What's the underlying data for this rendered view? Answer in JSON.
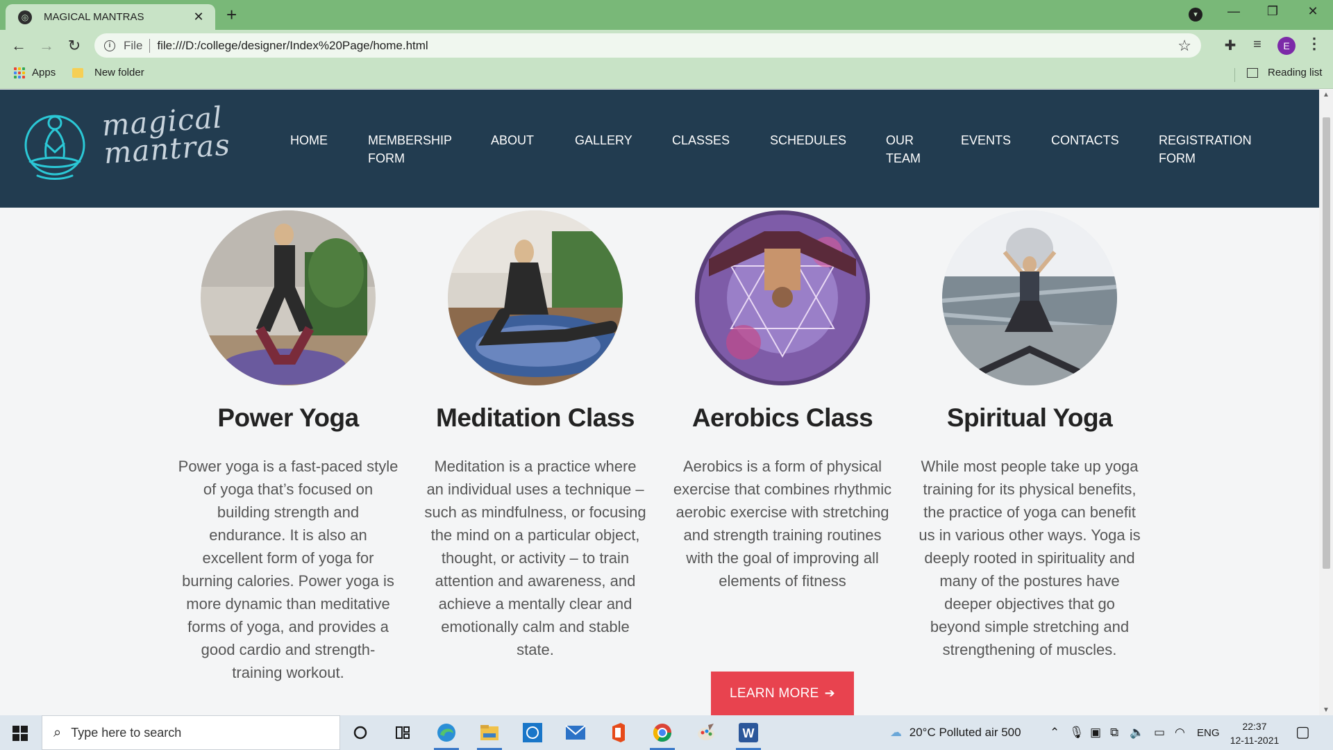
{
  "browser": {
    "tab_title": "MAGICAL MANTRAS",
    "url_scheme": "File",
    "url": "file:///D:/college/designer/Index%20Page/home.html",
    "profile_initial": "E",
    "bookmarks": [
      {
        "label": "Apps"
      },
      {
        "label": "New folder"
      }
    ],
    "reading_list": "Reading list"
  },
  "site": {
    "logo_text_line1": "magical",
    "logo_text_line2": "mantras",
    "nav": [
      {
        "label": "HOME"
      },
      {
        "label": "MEMBERSHIP FORM"
      },
      {
        "label": "ABOUT"
      },
      {
        "label": "GALLERY"
      },
      {
        "label": "CLASSES"
      },
      {
        "label": "SCHEDULES"
      },
      {
        "label": "OUR TEAM"
      },
      {
        "label": "EVENTS"
      },
      {
        "label": "CONTACTS"
      },
      {
        "label": "REGISTRATION FORM"
      }
    ],
    "cards": [
      {
        "title": "Power Yoga",
        "text": "Power yoga is a fast-paced style of yoga that’s focused on building strength and endurance. It is also an excellent form of yoga for burning calories. Power yoga is more dynamic than meditative forms of yoga, and provides a good cardio and strength-training workout."
      },
      {
        "title": "Meditation Class",
        "text": "Meditation is a practice where an individual uses a technique – such as mindfulness, or focusing the mind on a particular object, thought, or activity – to train attention and awareness, and achieve a mentally clear and emotionally calm and stable state."
      },
      {
        "title": "Aerobics Class",
        "text": "Aerobics is a form of physical exercise that combines rhythmic aerobic exercise with stretching and strength training routines with the goal of improving all elements of fitness"
      },
      {
        "title": "Spiritual Yoga",
        "text": "While most people take up yoga training for its physical benefits, the practice of yoga can benefit us in various other ways. Yoga is deeply rooted in spirituality and many of the postures have deeper objectives that go beyond simple stretching and strengthening of muscles."
      }
    ],
    "learn_more": "LEARN MORE",
    "colors": {
      "header_bg": "#223c50",
      "accent_button": "#e8434f",
      "logo_cyan": "#2bc8d6"
    }
  },
  "taskbar": {
    "search_placeholder": "Type here to search",
    "weather": "20°C  Polluted air 500",
    "language": "ENG",
    "time": "22:37",
    "date": "12-11-2021"
  }
}
